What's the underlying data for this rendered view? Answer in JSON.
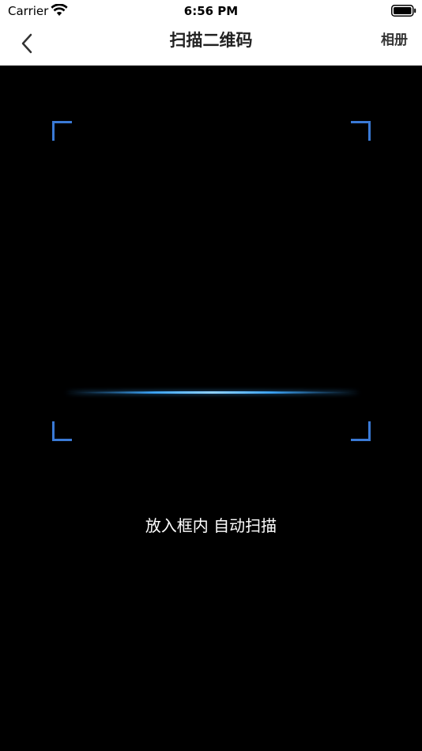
{
  "status_bar": {
    "carrier": "Carrier",
    "time": "6:56 PM",
    "wifi_icon": "wifi-icon",
    "battery_icon": "battery-icon"
  },
  "nav": {
    "back_icon": "chevron-left-icon",
    "title": "扫描二维码",
    "album_label": "相册"
  },
  "scanner": {
    "hint": "放入框内 自动扫描",
    "frame_color": "#3a7ad6",
    "line_color": "#3ea9ff"
  }
}
